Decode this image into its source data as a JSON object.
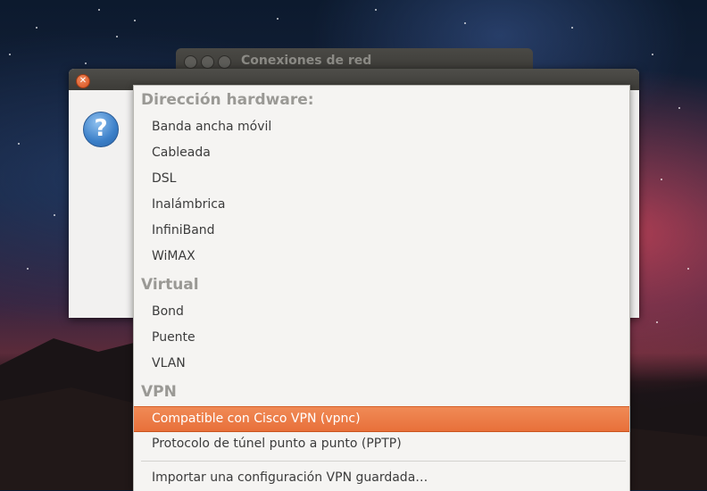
{
  "back_window": {
    "title": "Conexiones de red"
  },
  "dialog": {
    "help_glyph": "?",
    "close_glyph": "✕"
  },
  "menu": {
    "sections": [
      {
        "header": "Dirección hardware:",
        "items": [
          "Banda ancha móvil",
          "Cableada",
          "DSL",
          "Inalámbrica",
          "InfiniBand",
          "WiMAX"
        ]
      },
      {
        "header": "Virtual",
        "items": [
          "Bond",
          "Puente",
          "VLAN"
        ]
      },
      {
        "header": "VPN",
        "items": [
          "Compatible con Cisco VPN (vpnc)",
          "Protocolo de túnel punto a punto (PPTP)"
        ]
      }
    ],
    "import_label": "Importar una configuración VPN guardada…",
    "selected_item": "Compatible con Cisco VPN (vpnc)"
  },
  "colors": {
    "highlight": "#e9733d",
    "menu_bg": "#f5f4f2",
    "header_text": "#9a9995"
  }
}
